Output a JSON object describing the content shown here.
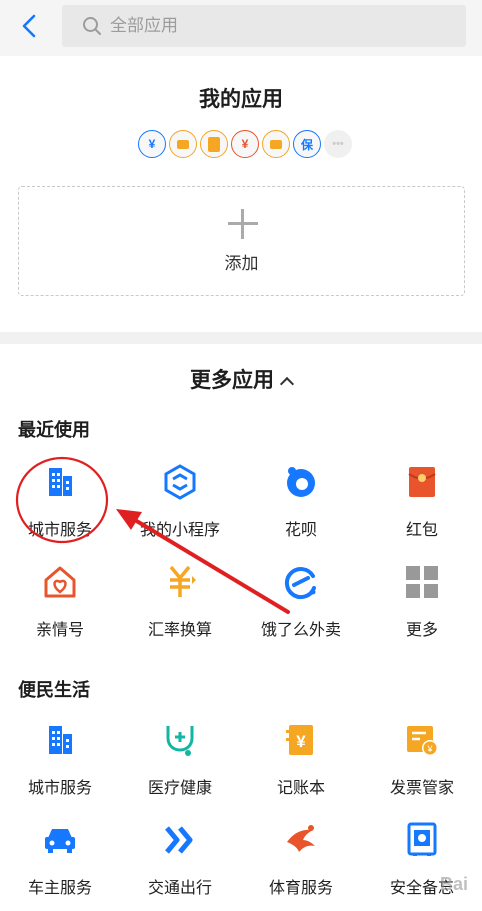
{
  "header": {
    "search_placeholder": "全部应用"
  },
  "my_apps": {
    "title": "我的应用",
    "mini_icons": [
      {
        "icon": "yuan-transfer-icon",
        "color": "#1677ff",
        "glyph": "¥"
      },
      {
        "icon": "card-icon",
        "color": "#f5a623",
        "glyph": ""
      },
      {
        "icon": "phone-icon",
        "color": "#f5a623",
        "glyph": ""
      },
      {
        "icon": "money-bag-icon",
        "color": "#e8542b",
        "glyph": "¥"
      },
      {
        "icon": "cup-icon",
        "color": "#f5a623",
        "glyph": ""
      },
      {
        "icon": "insurance-icon",
        "color": "#1677ff",
        "glyph": "保"
      },
      {
        "icon": "more-dots-icon",
        "color": "#cccccc",
        "glyph": "•••"
      }
    ],
    "add_label": "添加"
  },
  "more_apps": {
    "title": "更多应用"
  },
  "sections": [
    {
      "title": "最近使用",
      "items": [
        {
          "label": "城市服务",
          "icon": "city-building-icon"
        },
        {
          "label": "我的小程序",
          "icon": "mini-program-icon"
        },
        {
          "label": "花呗",
          "icon": "huabei-icon"
        },
        {
          "label": "红包",
          "icon": "red-envelope-icon"
        },
        {
          "label": "亲情号",
          "icon": "family-house-icon"
        },
        {
          "label": "汇率换算",
          "icon": "exchange-rate-icon"
        },
        {
          "label": "饿了么外卖",
          "icon": "eleme-icon"
        },
        {
          "label": "更多",
          "icon": "more-grid-icon"
        }
      ]
    },
    {
      "title": "便民生活",
      "items": [
        {
          "label": "城市服务",
          "icon": "city-building-icon"
        },
        {
          "label": "医疗健康",
          "icon": "medical-icon"
        },
        {
          "label": "记账本",
          "icon": "ledger-icon"
        },
        {
          "label": "发票管家",
          "icon": "invoice-icon"
        },
        {
          "label": "车主服务",
          "icon": "car-icon"
        },
        {
          "label": "交通出行",
          "icon": "transport-arrows-icon"
        },
        {
          "label": "体育服务",
          "icon": "sports-icon"
        },
        {
          "label": "安全备忘",
          "icon": "safe-box-icon"
        }
      ]
    }
  ],
  "colors": {
    "blue": "#1677ff",
    "orange": "#f5a623",
    "red": "#e8542b",
    "annotation_red": "#e02020"
  },
  "watermark": "Bai"
}
